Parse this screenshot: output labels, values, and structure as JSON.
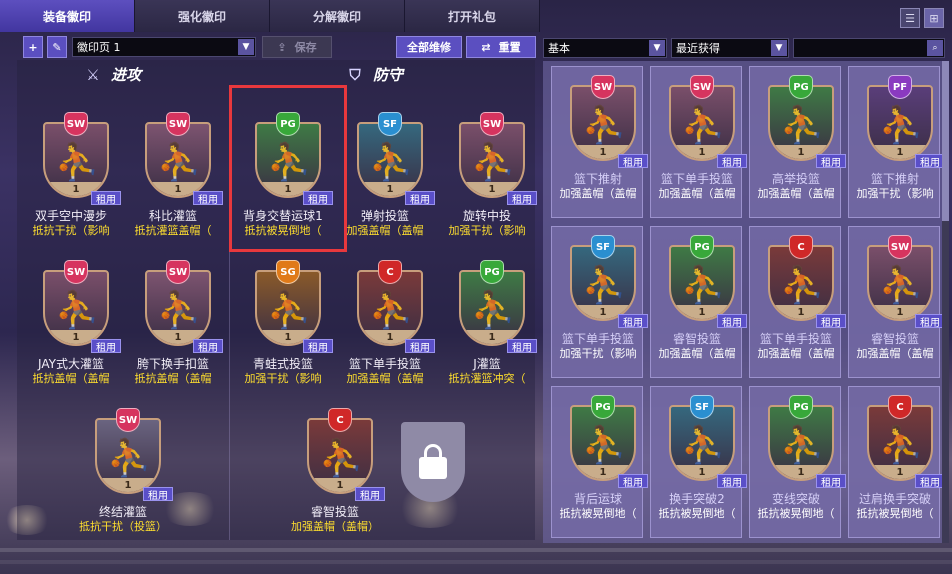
{
  "tabs": [
    {
      "label": "装备徽印",
      "active": true
    },
    {
      "label": "强化徽印",
      "active": false
    },
    {
      "label": "分解徽印",
      "active": false
    },
    {
      "label": "打开礼包",
      "active": false
    }
  ],
  "toolbar": {
    "page_select": "徽印页 1",
    "save_label": "保存",
    "repair_label": "全部维修",
    "reset_label": "重置"
  },
  "left_panel": {
    "offense_title": "进攻",
    "defense_title": "防守",
    "offense": [
      {
        "pos": "SW",
        "level": "1",
        "rent": "租用",
        "name": "双手空中漫步",
        "desc": "抵抗干扰（影响",
        "color": "#d6345f",
        "tone": "#7a4f6a"
      },
      {
        "pos": "SW",
        "level": "1",
        "rent": "租用",
        "name": "科比灌篮",
        "desc": "抵抗灌篮盖帽（",
        "color": "#d6345f",
        "tone": "#7d5470"
      },
      {
        "pos": "SW",
        "level": "1",
        "rent": "租用",
        "name": "JAY式大灌篮",
        "desc": "抵抗盖帽（盖帽",
        "color": "#d6345f",
        "tone": "#7a4f6a"
      },
      {
        "pos": "SW",
        "level": "1",
        "rent": "租用",
        "name": "胯下换手扣篮",
        "desc": "抵抗盖帽（盖帽",
        "color": "#d6345f",
        "tone": "#7d5470"
      },
      {
        "pos": "SW",
        "level": "1",
        "rent": "租用",
        "name": "终结灌篮",
        "desc": "抵抗干扰（投篮）",
        "color": "#d6345f",
        "tone": "#6a6480"
      }
    ],
    "defense": [
      {
        "pos": "PG",
        "level": "1",
        "rent": "租用",
        "name": "背身交替运球1",
        "desc": "抵抗被晃倒地（",
        "color": "#38a83a",
        "tone": "#3f7a45",
        "highlighted": true
      },
      {
        "pos": "SF",
        "level": "1",
        "rent": "租用",
        "name": "弹射投篮",
        "desc": "加强盖帽（盖帽",
        "color": "#2a8fd0",
        "tone": "#35687e"
      },
      {
        "pos": "SW",
        "level": "1",
        "rent": "租用",
        "name": "旋转中投",
        "desc": "加强干扰（影响",
        "color": "#d6345f",
        "tone": "#7a4f6a"
      },
      {
        "pos": "SG",
        "level": "1",
        "rent": "租用",
        "name": "青蛙式投篮",
        "desc": "加强干扰（影响",
        "color": "#e07a18",
        "tone": "#8a5a2a"
      },
      {
        "pos": "C",
        "level": "1",
        "rent": "租用",
        "name": "篮下单手投篮",
        "desc": "加强盖帽（盖帽",
        "color": "#d02828",
        "tone": "#7a3a3a"
      },
      {
        "pos": "PG",
        "level": "1",
        "rent": "租用",
        "name": "J灌篮",
        "desc": "抵抗灌篮冲突（",
        "color": "#38a83a",
        "tone": "#3f7a45"
      },
      {
        "pos": "C",
        "level": "1",
        "rent": "租用",
        "name": "睿智投篮",
        "desc": "加强盖帽（盖帽）",
        "color": "#d02828",
        "tone": "#7a3a3a"
      }
    ]
  },
  "right_panel": {
    "filter_select": "基本",
    "sort_select": "最近获得",
    "search_placeholder": "",
    "items": [
      {
        "pos": "SW",
        "level": "1",
        "rent": "租用",
        "name": "篮下推射",
        "desc": "加强盖帽（盖帽",
        "color": "#d6345f",
        "tone": "#7a4f6a"
      },
      {
        "pos": "SW",
        "level": "1",
        "rent": "租用",
        "name": "篮下单手投篮",
        "desc": "加强盖帽（盖帽",
        "color": "#d6345f",
        "tone": "#7a4f6a"
      },
      {
        "pos": "PG",
        "level": "1",
        "rent": "租用",
        "name": "高举投篮",
        "desc": "加强盖帽（盖帽",
        "color": "#38a83a",
        "tone": "#3f7a45"
      },
      {
        "pos": "PF",
        "level": "1",
        "rent": "租用",
        "name": "篮下推射",
        "desc": "加强干扰（影响",
        "color": "#8a3ac0",
        "tone": "#5a3e7a"
      },
      {
        "pos": "SF",
        "level": "1",
        "rent": "租用",
        "name": "篮下单手投篮",
        "desc": "加强干扰（影响",
        "color": "#2a8fd0",
        "tone": "#35687e"
      },
      {
        "pos": "PG",
        "level": "1",
        "rent": "租用",
        "name": "睿智投篮",
        "desc": "加强盖帽（盖帽",
        "color": "#38a83a",
        "tone": "#3f7a45"
      },
      {
        "pos": "C",
        "level": "1",
        "rent": "租用",
        "name": "篮下单手投篮",
        "desc": "加强盖帽（盖帽",
        "color": "#d02828",
        "tone": "#7a3a3a"
      },
      {
        "pos": "SW",
        "level": "1",
        "rent": "租用",
        "name": "睿智投篮",
        "desc": "加强盖帽（盖帽",
        "color": "#d6345f",
        "tone": "#7a4f6a"
      },
      {
        "pos": "PG",
        "level": "1",
        "rent": "租用",
        "name": "背后运球",
        "desc": "抵抗被晃倒地（",
        "color": "#38a83a",
        "tone": "#3f7a45"
      },
      {
        "pos": "SF",
        "level": "1",
        "rent": "租用",
        "name": "换手突破2",
        "desc": "抵抗被晃倒地（",
        "color": "#2a8fd0",
        "tone": "#35687e"
      },
      {
        "pos": "PG",
        "level": "1",
        "rent": "租用",
        "name": "变线突破",
        "desc": "抵抗被晃倒地（",
        "color": "#38a83a",
        "tone": "#3f7a45"
      },
      {
        "pos": "C",
        "level": "1",
        "rent": "租用",
        "name": "过肩换手突破",
        "desc": "抵抗被晃倒地（",
        "color": "#d02828",
        "tone": "#7a3a3a"
      }
    ]
  },
  "icons": {
    "offense_icon": "crossed-swords-icon",
    "defense_icon": "shield-icon",
    "add_icon": "plus-icon",
    "edit_icon": "pencil-icon",
    "save_icon": "upload-icon",
    "swap_icon": "swap-arrows-icon",
    "search_icon": "search-icon",
    "list_view_icon": "list-icon",
    "grid_view_icon": "grid-icon",
    "lock_icon": "lock-icon",
    "offense_glyph": "⚔",
    "defense_glyph": "⛉",
    "add_glyph": "+",
    "edit_glyph": "✎",
    "save_glyph": "⇪",
    "swap_glyph": "⇄",
    "search_glyph": "⌕",
    "list_glyph": "☰",
    "grid_glyph": "⊞",
    "figure_glyph": "⛹"
  }
}
